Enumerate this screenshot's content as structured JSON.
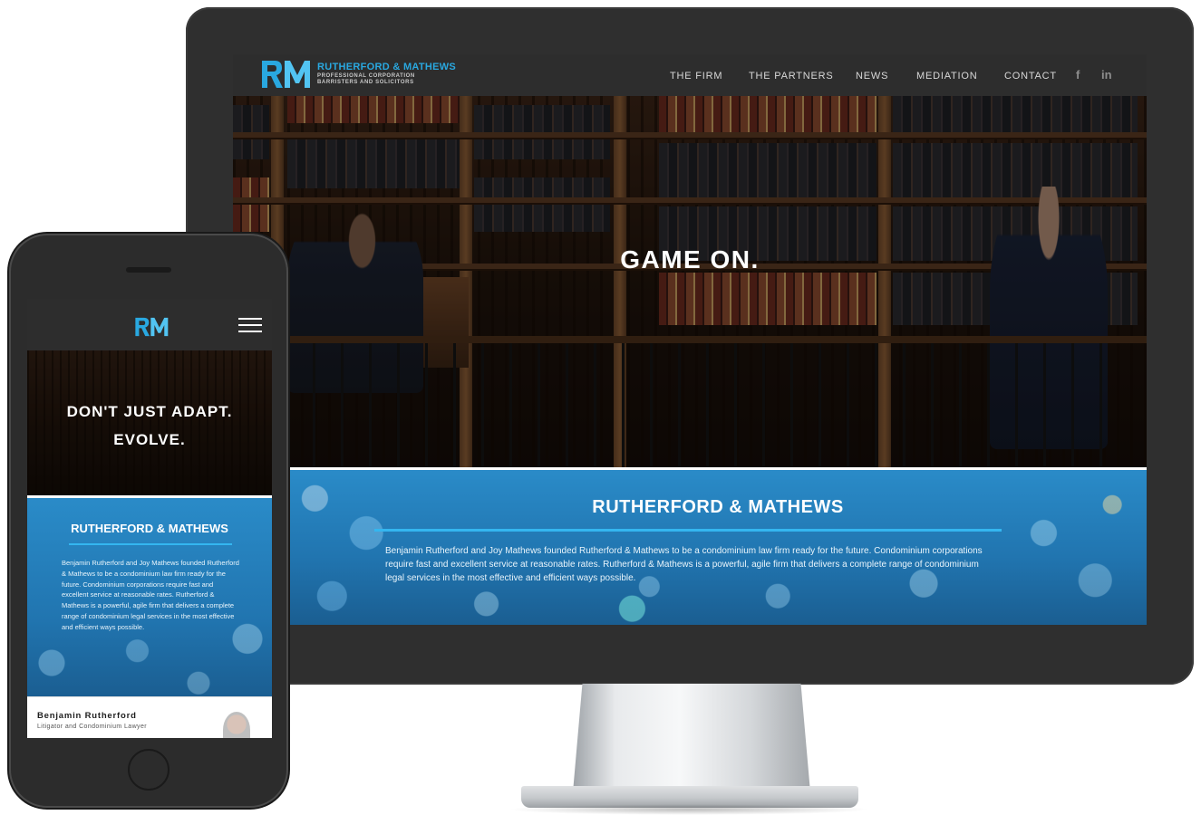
{
  "brand": {
    "name": "RUTHERFORD & MATHEWS",
    "sub1": "PROFESSIONAL CORPORATION",
    "sub2": "BARRISTERS AND SOLICITORS",
    "colors": {
      "blue": "#29a8e0",
      "dark": "#2d2d2d",
      "about_bg": "#2175b0"
    }
  },
  "desktop": {
    "nav": [
      {
        "label": "THE FIRM"
      },
      {
        "label": "THE PARTNERS"
      },
      {
        "label": "NEWS"
      },
      {
        "label": "MEDIATION"
      },
      {
        "label": "CONTACT"
      }
    ],
    "social": {
      "facebook": "f",
      "linkedin": "in"
    },
    "hero_title": "GAME ON.",
    "about": {
      "title": "RUTHERFORD & MATHEWS",
      "text": "Benjamin Rutherford and Joy Mathews founded Rutherford & Mathews to be a condominium law firm ready for the future. Condominium corporations require fast and excellent service at reasonable rates. Rutherford & Mathews is a powerful, agile firm that delivers a complete range of condominium legal services in the most effective and efficient ways possible."
    }
  },
  "mobile": {
    "hero_line1": "DON'T JUST ADAPT.",
    "hero_line2": "EVOLVE.",
    "about": {
      "title": "RUTHERFORD & MATHEWS",
      "text": "Benjamin Rutherford and Joy Mathews founded Rutherford & Mathews to be a condominium law firm ready for the future. Condominium corporations require fast and excellent service at reasonable rates. Rutherford & Mathews is a powerful, agile firm that delivers a complete range of condominium legal services in the most effective and efficient ways possible."
    },
    "partner": {
      "name": "Benjamin Rutherford",
      "role": "Litigator and Condominium Lawyer"
    }
  }
}
